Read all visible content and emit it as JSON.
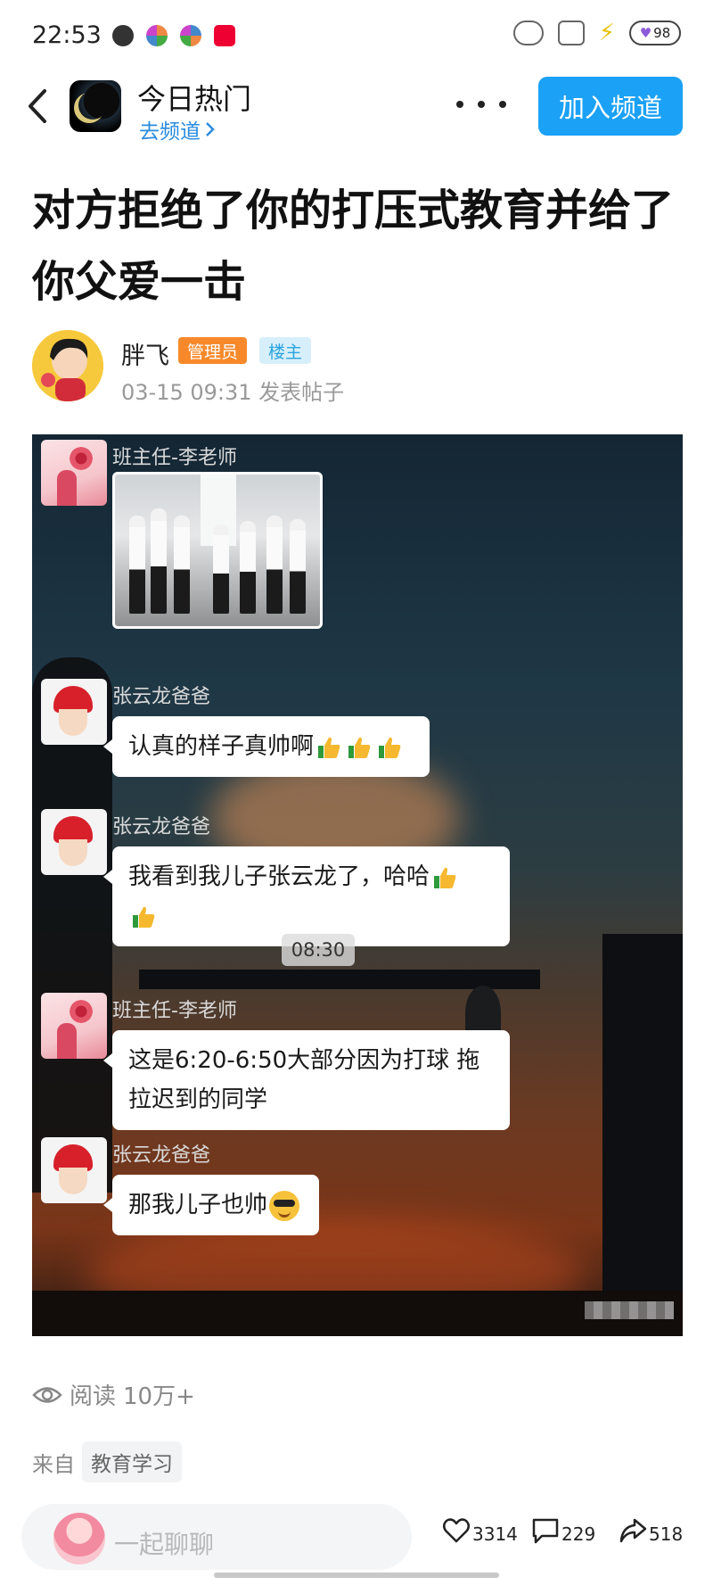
{
  "status_bar": {
    "time": "22:53",
    "battery": "98"
  },
  "channel": {
    "title": "今日热门",
    "link": "去频道",
    "join_label": "加入频道"
  },
  "post": {
    "title": "对方拒绝了你的打压式教育并给了你父爱一击",
    "author": "胖飞",
    "badge_admin": "管理员",
    "badge_owner": "楼主",
    "time": "03-15 09:31 发表帖子"
  },
  "chat": {
    "messages": [
      {
        "sender": "班主任-李老师",
        "type": "photo"
      },
      {
        "sender": "张云龙爸爸",
        "text": "认真的样子真帅啊"
      },
      {
        "sender": "张云龙爸爸",
        "text_line1": "我看到我儿子张云龙了，哈哈"
      },
      {
        "sender": "班主任-李老师",
        "text_line1": "这是6:20-6:50大部分因为打球 拖",
        "text_line2": "拉迟到的同学"
      },
      {
        "sender": "张云龙爸爸",
        "text": "那我儿子也帅"
      }
    ],
    "time_divider": "08:30"
  },
  "stats": {
    "read_label": "阅读",
    "read_count": "10万+",
    "source_label": "来自",
    "source_tag": "教育学习"
  },
  "bottom": {
    "placeholder": "一起聊聊",
    "likes": "3314",
    "comments": "229",
    "shares": "518"
  },
  "icons": [
    "back-arrow-icon",
    "more-icon",
    "eye-icon",
    "heart-icon",
    "comment-icon",
    "share-icon",
    "thumbs-up-icon",
    "cool-face-icon"
  ],
  "colors": {
    "accent": "#1ba1f6",
    "admin_badge": "#f7892b",
    "owner_badge_bg": "#d7effb",
    "link": "#2a8cdf"
  }
}
